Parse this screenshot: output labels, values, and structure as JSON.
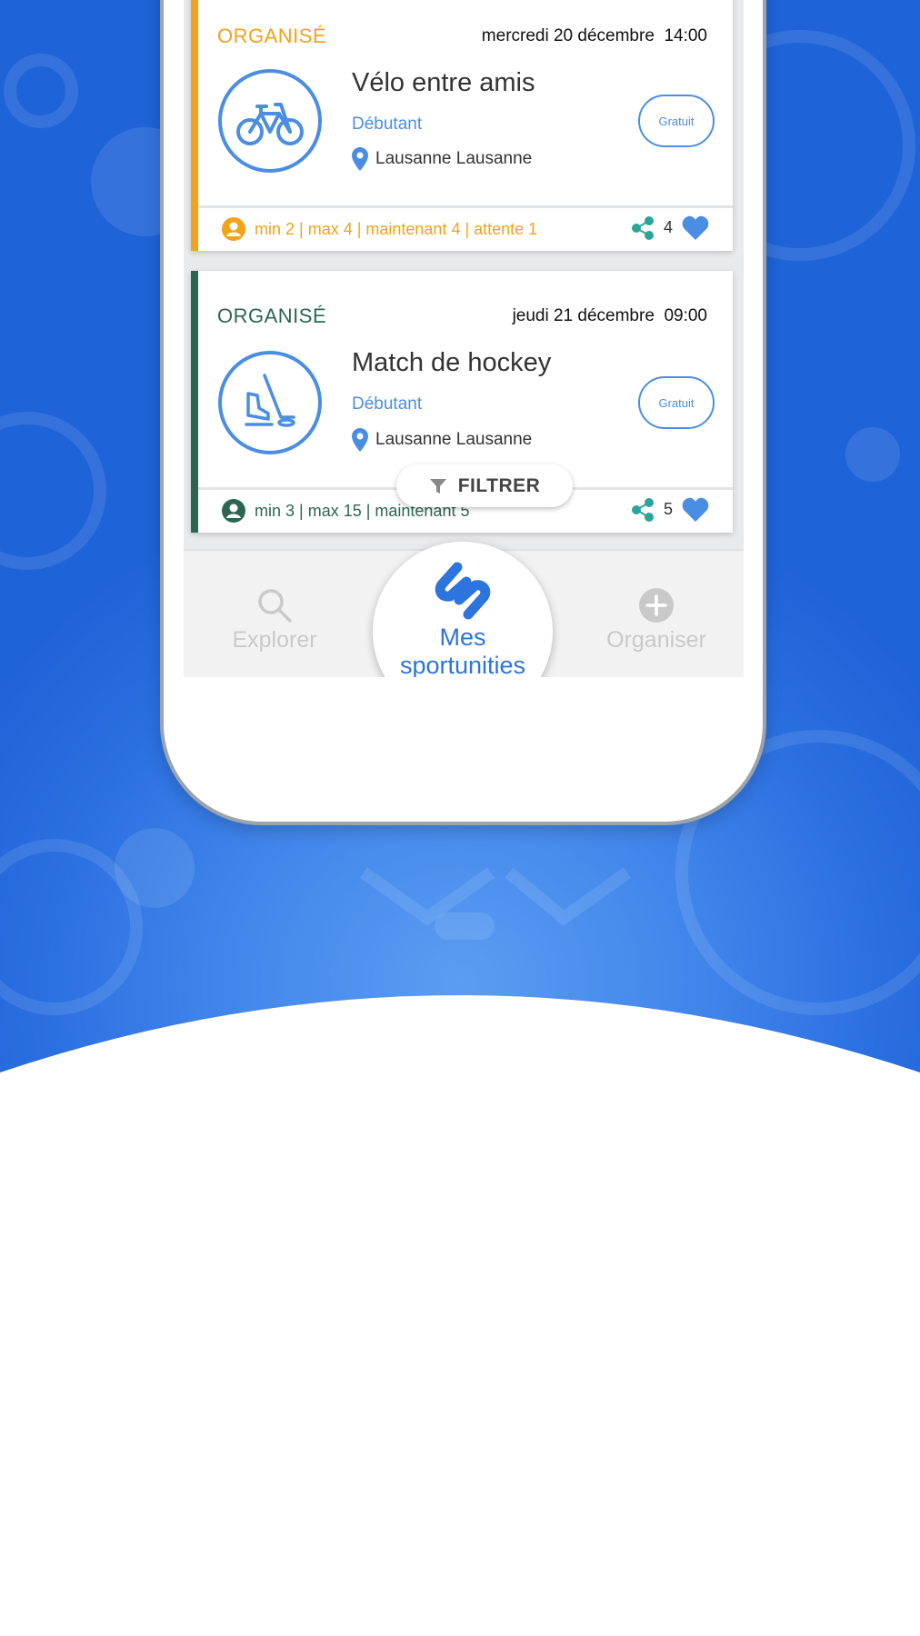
{
  "colors": {
    "accent_blue": "#4a8ee4",
    "organised_orange": "#f3a21a",
    "organised_green": "#2c6653",
    "background_blue": "#2a6fe0"
  },
  "events": [
    {
      "status": "ORGANISÉ",
      "date": "mercredi 20 décembre",
      "time": "14:00",
      "sport_icon": "bicycle-icon",
      "title": "Vélo entre amis",
      "level": "Débutant",
      "location": "Lausanne Lausanne",
      "price": "Gratuit",
      "participants": "min 2 | max 4 | maintenant 4 | attente 1",
      "shares": "4"
    },
    {
      "status": "ORGANISÉ",
      "date": "jeudi 21 décembre",
      "time": "09:00",
      "sport_icon": "hockey-icon",
      "title": "Match de hockey",
      "level": "Débutant",
      "location": "Lausanne Lausanne",
      "price": "Gratuit",
      "participants": "min 3 | max 15 | maintenant 5",
      "shares": "5"
    }
  ],
  "filter": {
    "label": "FILTRER",
    "icon": "filter-icon"
  },
  "nav": {
    "explore": {
      "label": "Explorer",
      "icon": "search-icon"
    },
    "mine": {
      "label_line1": "Mes",
      "label_line2": "sportunities",
      "icon": "sportunity-logo-icon"
    },
    "organise": {
      "label": "Organiser",
      "icon": "plus-circle-icon"
    }
  }
}
